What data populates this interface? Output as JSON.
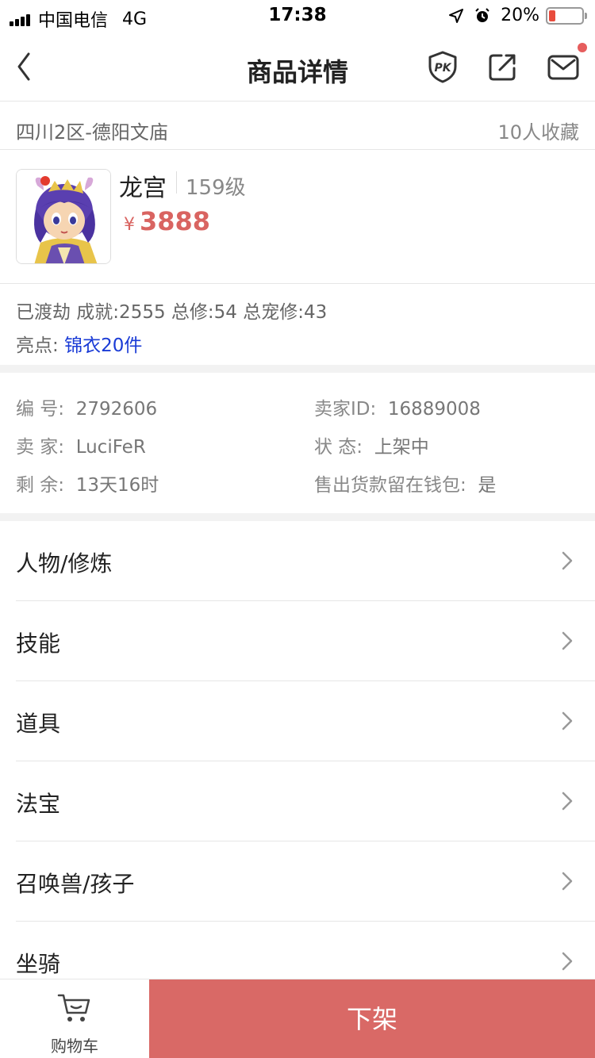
{
  "status_bar": {
    "carrier": "中国电信",
    "network": "4G",
    "time": "17:38",
    "battery_pct": "20%",
    "battery_level": 0.2
  },
  "nav": {
    "title": "商品详情",
    "icons": [
      "back-icon",
      "pk-icon",
      "share-icon",
      "mail-icon"
    ]
  },
  "server": {
    "name": "四川2区-德阳文庙",
    "favorites": "10人收藏"
  },
  "role": {
    "name": "龙宫",
    "level": "159级",
    "currency": "¥",
    "price": "3888"
  },
  "summary": {
    "stats": "已渡劫 成就:2555 总修:54 总宠修:43",
    "highlight_label": "亮点:",
    "highlight_value": "锦衣20件"
  },
  "info": {
    "serial_label": "编 号:",
    "serial_value": "2792606",
    "seller_id_label": "卖家ID:",
    "seller_id_value": "16889008",
    "seller_label": "卖 家:",
    "seller_value": "LuciFeR",
    "status_label": "状 态:",
    "status_value": "上架中",
    "remain_label": "剩 余:",
    "remain_value": "13天16时",
    "wallet_label": "售出货款留在钱包:",
    "wallet_value": "是"
  },
  "categories": [
    {
      "label": "人物/修炼"
    },
    {
      "label": "技能"
    },
    {
      "label": "道具"
    },
    {
      "label": "法宝"
    },
    {
      "label": "召唤兽/孩子"
    },
    {
      "label": "坐骑"
    }
  ],
  "bottom": {
    "cart_label": "购物车",
    "action_label": "下架"
  },
  "colors": {
    "price": "#d96461",
    "highlight": "#1a3bd6",
    "action": "#d96966",
    "unread_dot": "#e65d5d"
  }
}
